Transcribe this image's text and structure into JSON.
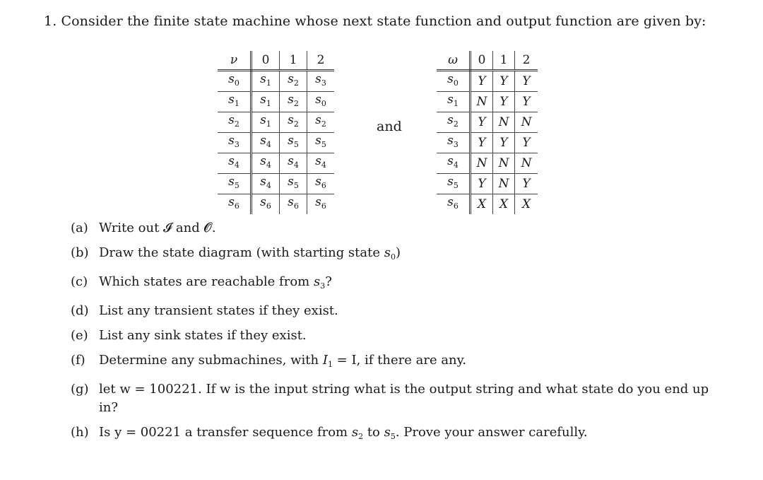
{
  "problem": {
    "number": "1.",
    "intro": "Consider the finite state machine whose next state function and output function are given by:"
  },
  "next_state_table": {
    "symbol": "ν",
    "columns": [
      "0",
      "1",
      "2"
    ],
    "rows": [
      {
        "state": "s",
        "idx": "0",
        "cells": [
          [
            "s",
            "1"
          ],
          [
            "s",
            "2"
          ],
          [
            "s",
            "3"
          ]
        ]
      },
      {
        "state": "s",
        "idx": "1",
        "cells": [
          [
            "s",
            "1"
          ],
          [
            "s",
            "2"
          ],
          [
            "s",
            "0"
          ]
        ]
      },
      {
        "state": "s",
        "idx": "2",
        "cells": [
          [
            "s",
            "1"
          ],
          [
            "s",
            "2"
          ],
          [
            "s",
            "2"
          ]
        ]
      },
      {
        "state": "s",
        "idx": "3",
        "cells": [
          [
            "s",
            "4"
          ],
          [
            "s",
            "5"
          ],
          [
            "s",
            "5"
          ]
        ]
      },
      {
        "state": "s",
        "idx": "4",
        "cells": [
          [
            "s",
            "4"
          ],
          [
            "s",
            "4"
          ],
          [
            "s",
            "4"
          ]
        ]
      },
      {
        "state": "s",
        "idx": "5",
        "cells": [
          [
            "s",
            "4"
          ],
          [
            "s",
            "5"
          ],
          [
            "s",
            "6"
          ]
        ]
      },
      {
        "state": "s",
        "idx": "6",
        "cells": [
          [
            "s",
            "6"
          ],
          [
            "s",
            "6"
          ],
          [
            "s",
            "6"
          ]
        ]
      }
    ]
  },
  "connector": "and",
  "output_table": {
    "symbol": "ω",
    "columns": [
      "0",
      "1",
      "2"
    ],
    "rows": [
      {
        "state": "s",
        "idx": "0",
        "cells": [
          "Y",
          "Y",
          "Y"
        ]
      },
      {
        "state": "s",
        "idx": "1",
        "cells": [
          "N",
          "Y",
          "Y"
        ]
      },
      {
        "state": "s",
        "idx": "2",
        "cells": [
          "Y",
          "N",
          "N"
        ]
      },
      {
        "state": "s",
        "idx": "3",
        "cells": [
          "Y",
          "Y",
          "Y"
        ]
      },
      {
        "state": "s",
        "idx": "4",
        "cells": [
          "N",
          "N",
          "N"
        ]
      },
      {
        "state": "s",
        "idx": "5",
        "cells": [
          "Y",
          "N",
          "Y"
        ]
      },
      {
        "state": "s",
        "idx": "6",
        "cells": [
          "X",
          "X",
          "X"
        ]
      }
    ]
  },
  "parts": [
    {
      "label": "(a)",
      "text": "Write out 𝓘 and 𝓞."
    },
    {
      "label": "(b)",
      "text_before": "Draw the state diagram (with starting state ",
      "var": "s",
      "sub": "0",
      "text_after": ")"
    },
    {
      "label": "(c)",
      "text_before": "Which states are reachable from ",
      "var": "s",
      "sub": "3",
      "text_after": "?"
    },
    {
      "label": "(d)",
      "text": "List any transient states if they exist."
    },
    {
      "label": "(e)",
      "text": "List any sink states if they exist."
    },
    {
      "label": "(f)",
      "text_before": "Determine any submachines, with ",
      "var": "I",
      "sub": "1",
      "text_after": " = I, if there are any."
    },
    {
      "label": "(g)",
      "text": "let w = 100221. If w is the input string what is the output string and what state do you end up in?"
    },
    {
      "label": "(h)",
      "text_before": "Is y = 00221 a transfer sequence from ",
      "var": "s",
      "sub": "2",
      "mid": " to ",
      "var2": "s",
      "sub2": "5",
      "text_after": ". Prove your answer carefully."
    }
  ]
}
